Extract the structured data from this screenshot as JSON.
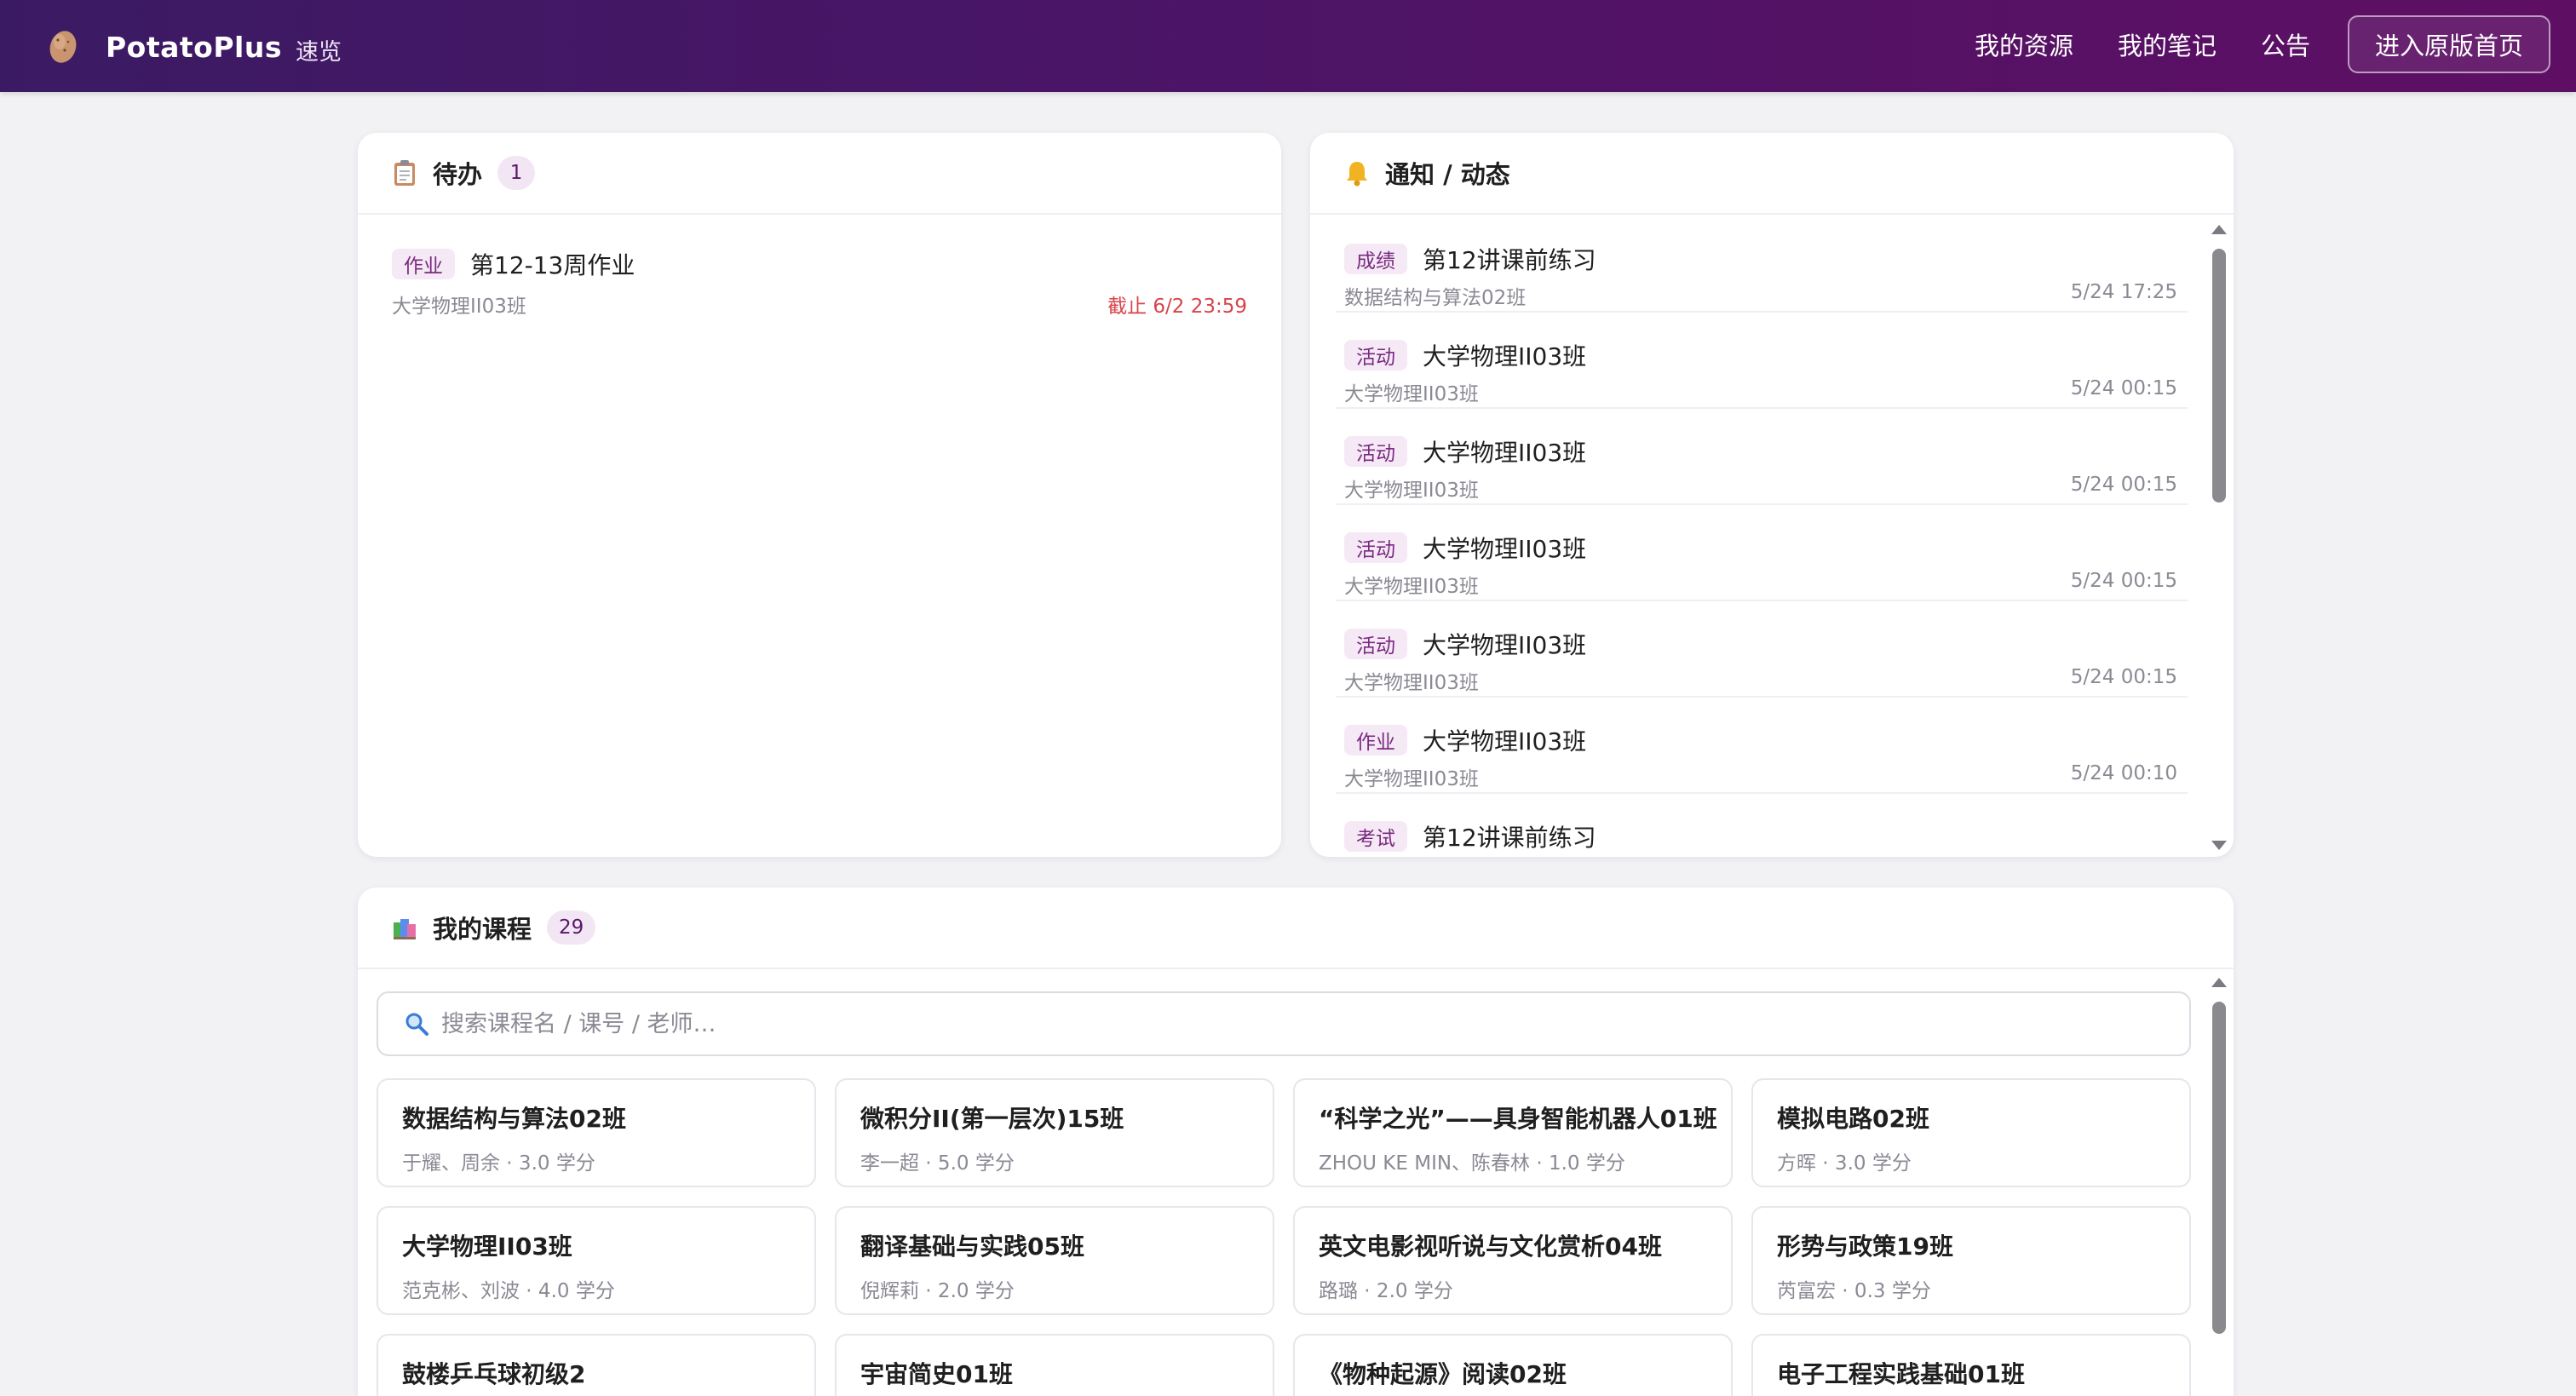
{
  "header": {
    "brand_name": "PotatoPlus",
    "brand_sub": "速览",
    "nav": [
      "我的资源",
      "我的笔记",
      "公告"
    ],
    "home_button": "进入原版首页"
  },
  "todo": {
    "title": "待办",
    "count": "1",
    "items": [
      {
        "tag": "作业",
        "title": "第12-13周作业",
        "course": "大学物理II03班",
        "deadline": "截止 6/2 23:59"
      }
    ]
  },
  "notify": {
    "title": "通知 / 动态",
    "items": [
      {
        "tag": "成绩",
        "title": "第12讲课前练习",
        "course": "数据结构与算法02班",
        "time": "5/24 17:25"
      },
      {
        "tag": "活动",
        "title": "大学物理II03班",
        "course": "大学物理II03班",
        "time": "5/24 00:15"
      },
      {
        "tag": "活动",
        "title": "大学物理II03班",
        "course": "大学物理II03班",
        "time": "5/24 00:15"
      },
      {
        "tag": "活动",
        "title": "大学物理II03班",
        "course": "大学物理II03班",
        "time": "5/24 00:15"
      },
      {
        "tag": "活动",
        "title": "大学物理II03班",
        "course": "大学物理II03班",
        "time": "5/24 00:15"
      },
      {
        "tag": "作业",
        "title": "大学物理II03班",
        "course": "大学物理II03班",
        "time": "5/24 00:10"
      },
      {
        "tag": "考试",
        "title": "第12讲课前练习",
        "course": "",
        "time": ""
      }
    ]
  },
  "courses": {
    "title": "我的课程",
    "count": "29",
    "search_placeholder": "搜索课程名 / 课号 / 老师…",
    "items": [
      {
        "name": "数据结构与算法02班",
        "meta": "于耀、周余 · 3.0 学分"
      },
      {
        "name": "微积分II(第一层次)15班",
        "meta": "李一超 · 5.0 学分"
      },
      {
        "name": "“科学之光”——具身智能机器人01班",
        "meta": "ZHOU KE MIN、陈春林 · 1.0 学分"
      },
      {
        "name": "模拟电路02班",
        "meta": "方晖 · 3.0 学分"
      },
      {
        "name": "大学物理II03班",
        "meta": "范克彬、刘波 · 4.0 学分"
      },
      {
        "name": "翻译基础与实践05班",
        "meta": "倪辉莉 · 2.0 学分"
      },
      {
        "name": "英文电影视听说与文化赏析04班",
        "meta": "路璐 · 2.0 学分"
      },
      {
        "name": "形势与政策19班",
        "meta": "芮富宏 · 0.3 学分"
      },
      {
        "name": "鼓楼乒乓球初级2",
        "meta": ""
      },
      {
        "name": "宇宙简史01班",
        "meta": ""
      },
      {
        "name": "《物种起源》阅读02班",
        "meta": ""
      },
      {
        "name": "电子工程实践基础01班",
        "meta": ""
      }
    ]
  }
}
